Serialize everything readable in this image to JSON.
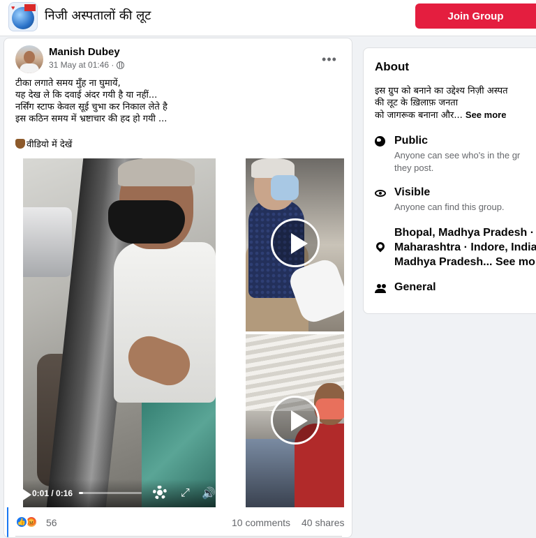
{
  "header": {
    "group_name": "निजी अस्पतालों की लूट",
    "join_label": "Join Group",
    "avatar_icon": "group-logo"
  },
  "post": {
    "author": "Manish Dubey",
    "timestamp": "31 May at 01:46 ·",
    "privacy_icon": "globe-icon",
    "more_icon": "•••",
    "text_lines": [
      "टीका लगाते समय मुँह ना घुमायें,",
      "यह देख ले कि दवाई अंदर गयी है या नहीं...",
      "नर्सिंग स्टाफ केवल सूई चुभा कर निकाल लेते है",
      "इस कठिन समय में भ्रष्टाचार की हद हो गयी ..."
    ],
    "cta_text": "वीडियो में देखें",
    "video": {
      "time": "0:01 / 0:16",
      "progress_fraction": 0.0625,
      "fullscreen_glyph": "⤢",
      "volume_glyph": "🔊"
    },
    "reactions": {
      "count": "56",
      "like_glyph": "👍",
      "angry_glyph": "😡"
    },
    "comments": "10 comments",
    "shares": "40 shares"
  },
  "about": {
    "title": "About",
    "description_lines": [
      "इस ग्रुप को बनाने का उद्देश्य निज़ी अस्पत",
      "की लूट के ख़िलाफ़ जनता",
      "को जागरूक बनाना और..."
    ],
    "see_more": "See more",
    "public": {
      "title": "Public",
      "line1": "Anyone can see who's in the gr",
      "line2": "they post."
    },
    "visible": {
      "title": "Visible",
      "line1": "Anyone can find this group."
    },
    "location": {
      "line1": "Bhopal, Madhya Pradesh ·",
      "line2": "Maharashtra · Indore, India",
      "line3": "Madhya Pradesh...",
      "see_more": "See mo"
    },
    "general": {
      "title": "General"
    }
  },
  "colors": {
    "join_button": "#e41e3f",
    "link_blue": "#1877f2",
    "secondary_text": "#65676b",
    "page_bg": "#f0f2f5"
  }
}
